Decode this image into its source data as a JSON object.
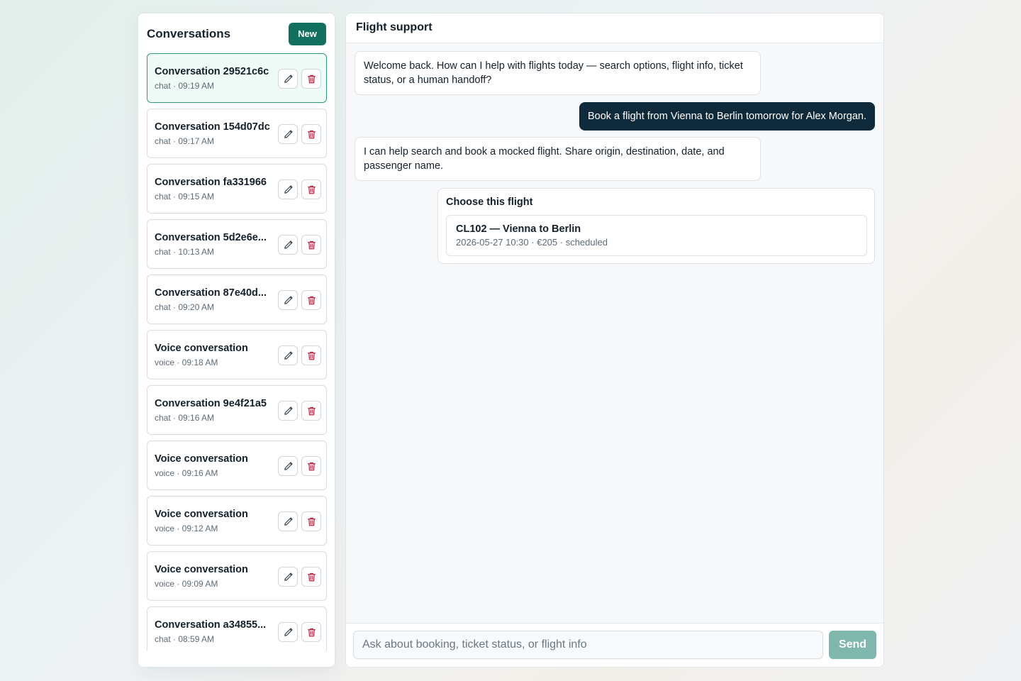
{
  "sidebar": {
    "title": "Conversations",
    "new_label": "New",
    "conversations": [
      {
        "title": "Conversation 29521c6c",
        "meta": "chat · 09:19 AM",
        "active": true
      },
      {
        "title": "Conversation 154d07dc",
        "meta": "chat · 09:17 AM"
      },
      {
        "title": "Conversation fa331966",
        "meta": "chat · 09:15 AM"
      },
      {
        "title": "Conversation 5d2e6e...",
        "meta": "chat · 10:13 AM"
      },
      {
        "title": "Conversation 87e40d...",
        "meta": "chat · 09:20 AM"
      },
      {
        "title": "Voice conversation",
        "meta": "voice · 09:18 AM"
      },
      {
        "title": "Conversation 9e4f21a5",
        "meta": "chat · 09:16 AM"
      },
      {
        "title": "Voice conversation",
        "meta": "voice · 09:16 AM"
      },
      {
        "title": "Voice conversation",
        "meta": "voice · 09:12 AM"
      },
      {
        "title": "Voice conversation",
        "meta": "voice · 09:09 AM"
      },
      {
        "title": "Conversation a34855...",
        "meta": "chat · 08:59 AM"
      }
    ],
    "edit_icon": "pencil-icon",
    "delete_icon": "trash-icon"
  },
  "chat": {
    "title": "Flight support",
    "messages": [
      {
        "role": "assistant",
        "text": "Welcome back. How can I help with flights today — search options, flight info, ticket status, or a human handoff?"
      },
      {
        "role": "user",
        "text": "Book a flight from Vienna to Berlin tomorrow for Alex Morgan."
      },
      {
        "role": "assistant",
        "text": "I can help search and book a mocked flight. Share origin, destination, date, and passenger name."
      }
    ],
    "flight_card": {
      "title": "Choose this flight",
      "flight": {
        "code": "CL102",
        "route": "Vienna to Berlin",
        "datetime": "2026-05-27 10:30",
        "price": "€205",
        "status": "scheduled"
      }
    }
  },
  "composer": {
    "placeholder": "Ask about booking, ticket status, or flight info",
    "send_label": "Send"
  },
  "colors": {
    "accent": "#12705f",
    "user_bubble": "#0f2a3a",
    "send_disabled": "#7fb7ad",
    "delete": "#c0233f"
  }
}
